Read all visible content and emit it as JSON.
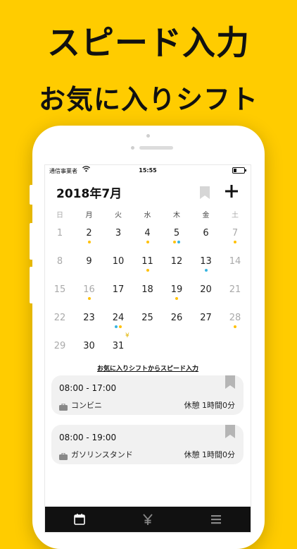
{
  "headline": {
    "line1": "スピード入力",
    "line2": "お気に入りシフト"
  },
  "status_bar": {
    "carrier": "通信事業者",
    "time": "15:55"
  },
  "calendar": {
    "title": "2018年7月",
    "weekdays": [
      "日",
      "月",
      "火",
      "水",
      "木",
      "金",
      "土"
    ],
    "weeks": [
      [
        {
          "d": "1",
          "muted": true
        },
        {
          "d": "2",
          "dots": [
            "y"
          ]
        },
        {
          "d": "3"
        },
        {
          "d": "4",
          "dots": [
            "y"
          ]
        },
        {
          "d": "5",
          "dots": [
            "y",
            "b"
          ]
        },
        {
          "d": "6"
        },
        {
          "d": "7",
          "muted": true,
          "dots": [
            "y"
          ]
        }
      ],
      [
        {
          "d": "8",
          "muted": true
        },
        {
          "d": "9"
        },
        {
          "d": "10"
        },
        {
          "d": "11",
          "today": true,
          "dots": [
            "y"
          ]
        },
        {
          "d": "12"
        },
        {
          "d": "13",
          "dots": [
            "b"
          ]
        },
        {
          "d": "14",
          "muted": true
        }
      ],
      [
        {
          "d": "15",
          "muted": true
        },
        {
          "d": "16",
          "muted": true,
          "dots": [
            "y"
          ]
        },
        {
          "d": "17"
        },
        {
          "d": "18"
        },
        {
          "d": "19",
          "dots": [
            "y"
          ]
        },
        {
          "d": "20"
        },
        {
          "d": "21",
          "muted": true
        }
      ],
      [
        {
          "d": "22",
          "muted": true
        },
        {
          "d": "23"
        },
        {
          "d": "24",
          "dots": [
            "b",
            "y"
          ]
        },
        {
          "d": "25"
        },
        {
          "d": "26"
        },
        {
          "d": "27"
        },
        {
          "d": "28",
          "muted": true,
          "dots": [
            "y"
          ]
        }
      ],
      [
        {
          "d": "29",
          "muted": true
        },
        {
          "d": "30"
        },
        {
          "d": "31"
        }
      ]
    ],
    "yen_marker": "¥"
  },
  "favorites": {
    "link_label": "お気に入りシフトからスピード入力",
    "shifts": [
      {
        "time": "08:00 - 17:00",
        "place": "コンビニ",
        "break": "休憩 1時間0分"
      },
      {
        "time": "08:00 - 19:00",
        "place": "ガソリンスタンド",
        "break": "休憩 1時間0分"
      }
    ]
  },
  "tabbar": {
    "icons": [
      "calendar-icon",
      "yen-icon",
      "menu-icon"
    ]
  },
  "colors": {
    "background": "#FFCC00",
    "dot_yellow": "#FFC107",
    "dot_blue": "#36B4E0",
    "tabbar": "#111111"
  }
}
